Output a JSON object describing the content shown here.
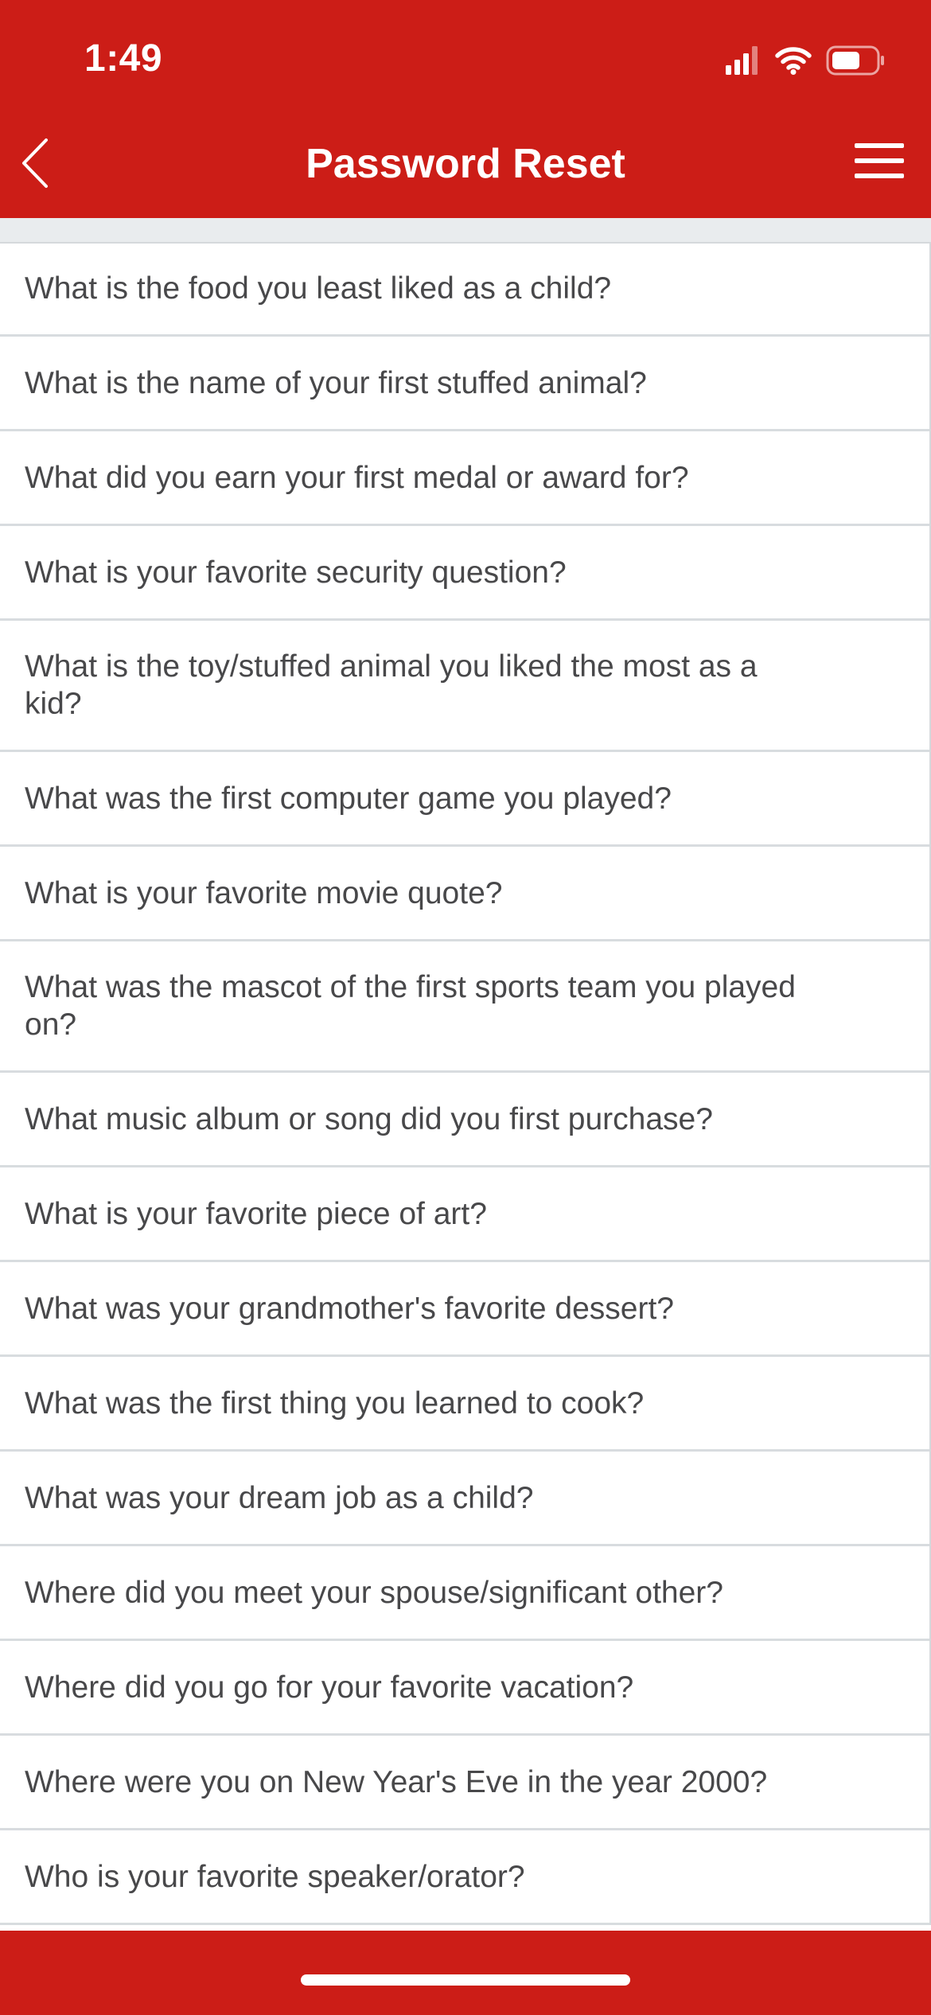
{
  "status_bar": {
    "time": "1:49"
  },
  "header": {
    "title": "Password Reset",
    "back_icon": "chevron-left-icon",
    "menu_icon": "hamburger-menu-icon",
    "background_color": "#cc1d17"
  },
  "questions": [
    "What is the food you least liked as a child?",
    "What is the name of your first stuffed animal?",
    "What did you earn your first medal or award for?",
    "What is your favorite security question?",
    "What is the toy/stuffed animal you liked the most as a kid?",
    "What was the first computer game you played?",
    "What is your favorite movie quote?",
    "What was the mascot of the first sports team you played on?",
    "What music album or song did you first purchase?",
    "What is your favorite piece of art?",
    "What was your grandmother's favorite dessert?",
    "What was the first thing you learned to cook?",
    "What was your dream job as a child?",
    "Where did you meet your spouse/significant other?",
    "Where did you go for your favorite vacation?",
    "Where were you on New Year's Eve in the year 2000?",
    "Who is your favorite speaker/orator?"
  ]
}
